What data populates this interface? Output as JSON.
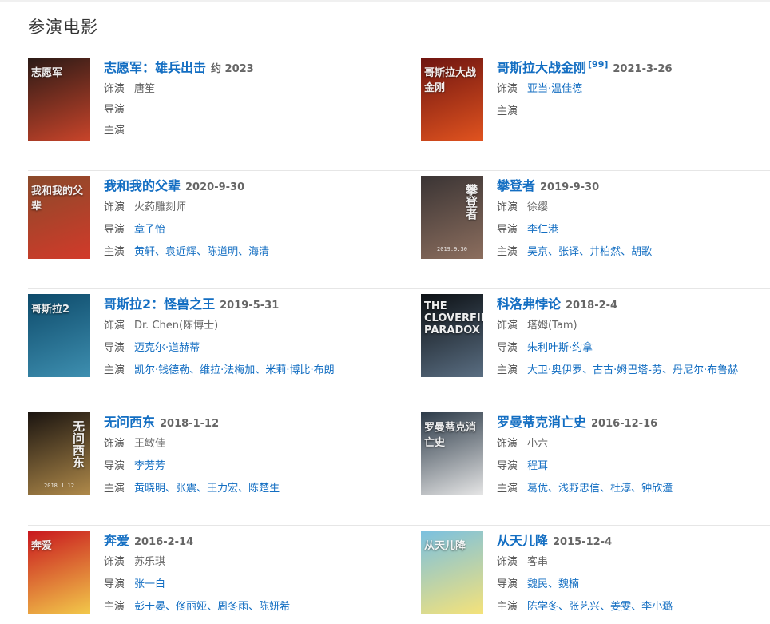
{
  "section_title": "参演电影",
  "labels": {
    "role": "饰演",
    "director": "导演",
    "starring": "主演"
  },
  "films": [
    {
      "title": "志愿军：雄兵出击",
      "date": "约 2023",
      "ref": "",
      "role": "唐笙",
      "directors": [],
      "stars": [],
      "poster": {
        "bg": "#2a1a16",
        "accent": "#c8442a",
        "text": "志愿军",
        "foot": "",
        "vertical": false
      }
    },
    {
      "title": "哥斯拉大战金刚",
      "date": "2021-3-26",
      "ref": "[99]",
      "role": "",
      "directors": [
        "亚当·温佳德"
      ],
      "stars": [],
      "poster": {
        "bg": "#6e1410",
        "accent": "#e0531f",
        "text": "哥斯拉大战金刚",
        "foot": "",
        "vertical": false
      }
    },
    {
      "title": "我和我的父辈",
      "date": "2020-9-30",
      "ref": "",
      "role": "火药雕刻师",
      "directors": [
        "章子怡"
      ],
      "stars": [
        "黄轩",
        "袁近辉",
        "陈道明",
        "海清"
      ],
      "poster": {
        "bg": "#8a4a2a",
        "accent": "#d23a2a",
        "text": "我和我的父辈",
        "foot": "",
        "vertical": false
      }
    },
    {
      "title": "攀登者",
      "date": "2019-9-30",
      "ref": "",
      "role": "徐缨",
      "directors": [
        "李仁港"
      ],
      "stars": [
        "吴京",
        "张译",
        "井柏然",
        "胡歌"
      ],
      "poster": {
        "bg": "#3a3434",
        "accent": "#8c6e5e",
        "text": "攀登者",
        "foot": "2019.9.30",
        "vertical": true
      }
    },
    {
      "title": "哥斯拉2：怪兽之王",
      "date": "2019-5-31",
      "ref": "",
      "role": "Dr. Chen(陈博士)",
      "directors": [
        "迈克尔·道赫蒂"
      ],
      "stars": [
        "凯尔·钱德勒",
        "维拉·法梅加",
        "米莉·博比·布朗"
      ],
      "poster": {
        "bg": "#0d4a6a",
        "accent": "#3e8fb0",
        "text": "哥斯拉2",
        "foot": "",
        "vertical": false
      }
    },
    {
      "title": "科洛弗悖论",
      "date": "2018-2-4",
      "ref": "",
      "role": "塔姆(Tam)",
      "directors": [
        "朱利叶斯·约拿"
      ],
      "stars": [
        "大卫·奥伊罗",
        "古古·姆巴塔-劳",
        "丹尼尔·布鲁赫"
      ],
      "poster": {
        "bg": "#0c1014",
        "accent": "#5a6e82",
        "text": "THE CLOVERFIELD PARADOX",
        "foot": "",
        "vertical": false
      }
    },
    {
      "title": "无问西东",
      "date": "2018-1-12",
      "ref": "",
      "role": "王敏佳",
      "directors": [
        "李芳芳"
      ],
      "stars": [
        "黄晓明",
        "张震",
        "王力宏",
        "陈楚生"
      ],
      "poster": {
        "bg": "#1a1410",
        "accent": "#b08a4a",
        "text": "无问西东",
        "foot": "2018.1.12",
        "vertical": true
      }
    },
    {
      "title": "罗曼蒂克消亡史",
      "date": "2016-12-16",
      "ref": "",
      "role": "小六",
      "directors": [
        "程耳"
      ],
      "stars": [
        "葛优",
        "浅野忠信",
        "杜淳",
        "钟欣潼"
      ],
      "poster": {
        "bg": "#2c3a48",
        "accent": "#e6e6e6",
        "text": "罗曼蒂克消亡史",
        "foot": "",
        "vertical": false
      }
    },
    {
      "title": "奔爱",
      "date": "2016-2-14",
      "ref": "",
      "role": "苏乐琪",
      "directors": [
        "张一白"
      ],
      "stars": [
        "彭于晏",
        "佟丽娅",
        "周冬雨",
        "陈妍希"
      ],
      "poster": {
        "bg": "#c8161e",
        "accent": "#f2c84a",
        "text": "奔爱",
        "foot": "",
        "vertical": false
      }
    },
    {
      "title": "从天儿降",
      "date": "2015-12-4",
      "ref": "",
      "role": "客串",
      "directors": [
        "魏民",
        "魏楠"
      ],
      "stars": [
        "陈学冬",
        "张艺兴",
        "姜雯",
        "李小璐"
      ],
      "poster": {
        "bg": "#7ac0e0",
        "accent": "#f4e27a",
        "text": "从天儿降",
        "foot": "",
        "vertical": false
      }
    }
  ]
}
